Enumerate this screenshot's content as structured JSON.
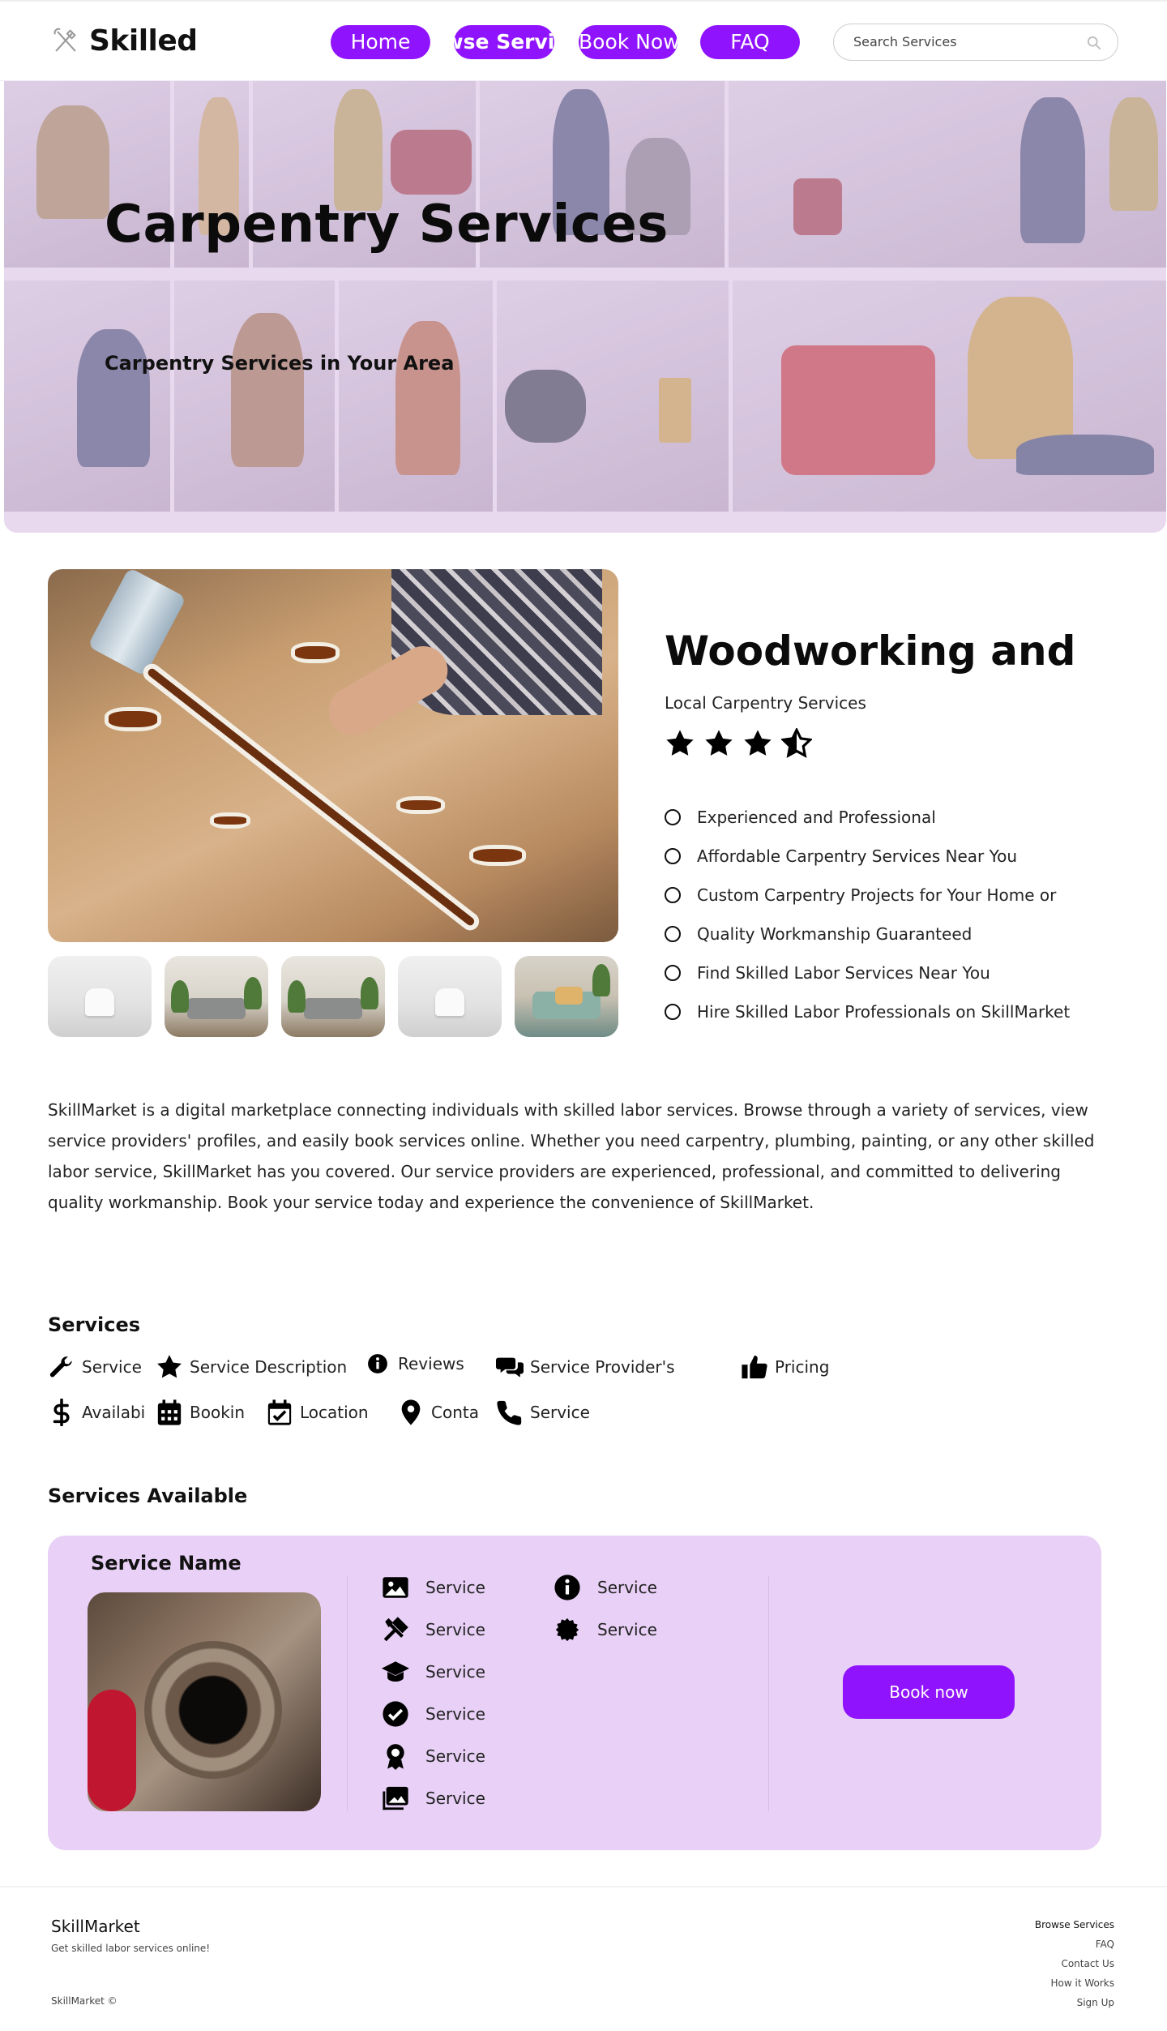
{
  "brand": {
    "name": "Skilled",
    "accent": "#9013fe",
    "card_bg": "#e8d0f6"
  },
  "nav": {
    "home": "Home",
    "browse": "Browse Services",
    "book": "Book Now",
    "faq": "FAQ"
  },
  "search": {
    "placeholder": "Search Services",
    "icon": "search-icon"
  },
  "hero": {
    "title": "Carpentry Services",
    "subtitle": "Carpentry Services in Your Area"
  },
  "product": {
    "title": "Woodworking and",
    "subtitle": "Local Carpentry Services",
    "rating": 3.5,
    "rating_max": 4,
    "features": [
      "Experienced and Professional",
      "Affordable Carpentry Services Near You",
      "Custom Carpentry Projects for Your Home or",
      "Quality Workmanship Guaranteed",
      "Find Skilled Labor Services Near You",
      "Hire Skilled Labor Professionals on SkillMarket"
    ]
  },
  "description": "SkillMarket is a digital marketplace connecting individuals with skilled labor services. Browse through a variety of services, view service providers' profiles, and easily book services online. Whether you need carpentry, plumbing, painting, or any other skilled labor service, SkillMarket has you covered. Our service providers are experienced, professional, and committed to delivering quality workmanship. Book your service today and experience the convenience of SkillMarket.",
  "services": {
    "title": "Services",
    "items": [
      {
        "label": "Service",
        "icon": "wrench-icon"
      },
      {
        "label": "Service Description",
        "icon": "star-icon"
      },
      {
        "label": "Reviews",
        "icon": "info-icon"
      },
      {
        "label": "Service Provider's",
        "icon": "chat-icon"
      },
      {
        "label": "Pricing",
        "icon": "thumbs-up-icon"
      },
      {
        "label": "Availabi",
        "icon": "dollar-icon"
      },
      {
        "label": "Bookin",
        "icon": "calendar-icon"
      },
      {
        "label": "Location",
        "icon": "calendar-check-icon"
      },
      {
        "label": "Conta",
        "icon": "map-pin-icon"
      },
      {
        "label": "Service",
        "icon": "phone-icon"
      }
    ]
  },
  "available": {
    "title": "Services Available",
    "card": {
      "name": "Service Name",
      "col1": [
        {
          "label": "Service",
          "icon": "image-icon"
        },
        {
          "label": "Service",
          "icon": "tools-icon"
        },
        {
          "label": "Service",
          "icon": "graduation-cap-icon"
        },
        {
          "label": "Service",
          "icon": "check-circle-icon"
        },
        {
          "label": "Service",
          "icon": "award-icon"
        },
        {
          "label": "Service",
          "icon": "images-icon"
        }
      ],
      "col2": [
        {
          "label": "Service",
          "icon": "info-icon"
        },
        {
          "label": "Service",
          "icon": "certificate-icon"
        }
      ],
      "button": "Book now"
    }
  },
  "footer": {
    "brand": "SkillMarket",
    "tagline": "Get skilled labor services online!",
    "copyright": "SkillMarket ©",
    "links": [
      "Browse Services",
      "FAQ",
      "Contact Us",
      "How it Works",
      "Sign Up"
    ]
  }
}
